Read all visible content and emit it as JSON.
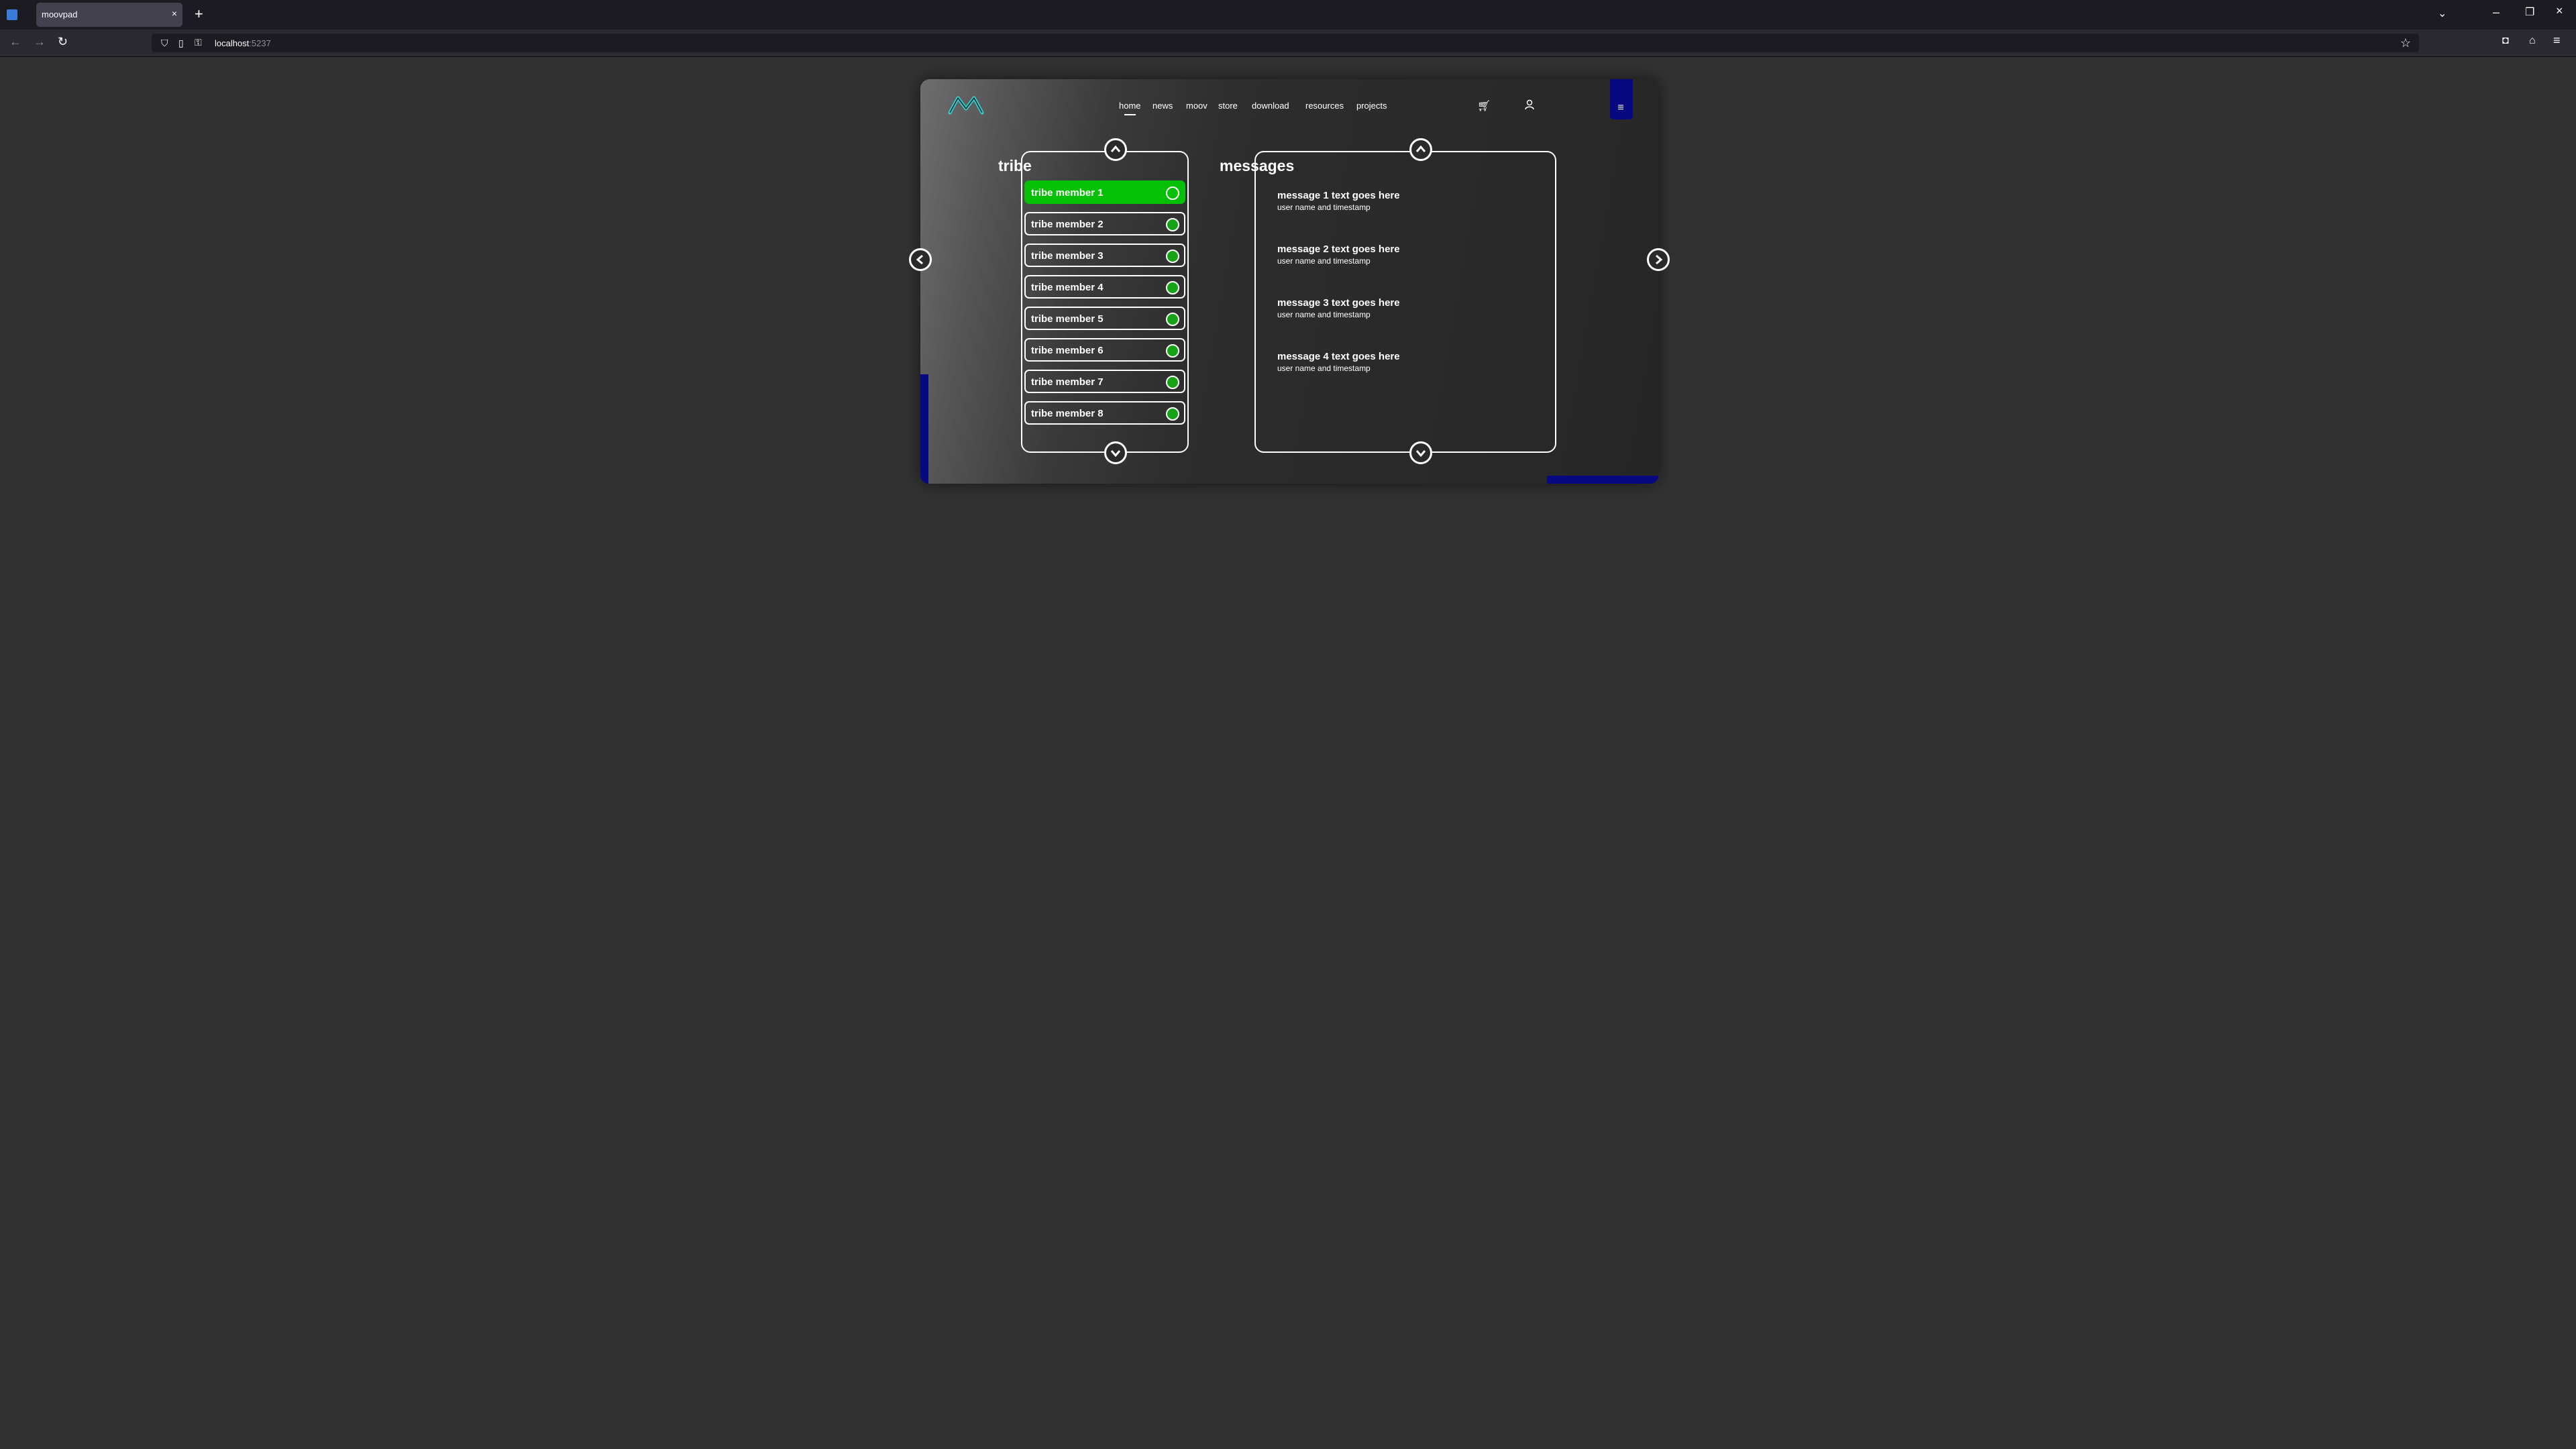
{
  "browser": {
    "tab_title": "moovpad",
    "tab_close": "×",
    "new_tab": "+",
    "url_host": "localhost",
    "url_port": ":5237"
  },
  "app": {
    "nav": [
      {
        "label": "home",
        "active": true
      },
      {
        "label": "news"
      },
      {
        "label": "moov"
      },
      {
        "label": "store"
      },
      {
        "label": "download"
      },
      {
        "label": "resources"
      },
      {
        "label": "projects"
      }
    ],
    "colors": {
      "accent_blue": "#060980",
      "online_green": "#06c006",
      "logo_teal": "#2fd3d6"
    },
    "icons": {
      "cart": "cart-icon",
      "user": "user-icon",
      "menu": "menu-icon"
    },
    "tribe": {
      "title": "tribe",
      "members": [
        {
          "name": "tribe member 1",
          "selected": true
        },
        {
          "name": "tribe member 2"
        },
        {
          "name": "tribe member 3"
        },
        {
          "name": "tribe member 4"
        },
        {
          "name": "tribe member 5"
        },
        {
          "name": "tribe member 6"
        },
        {
          "name": "tribe member 7"
        },
        {
          "name": "tribe member 8"
        }
      ]
    },
    "messages": {
      "title": "messages",
      "items": [
        {
          "text": "message 1 text goes here",
          "meta": "user name and timestamp"
        },
        {
          "text": "message 2 text goes here",
          "meta": "user name and timestamp"
        },
        {
          "text": "message 3 text goes here",
          "meta": "user name and timestamp"
        },
        {
          "text": "message 4 text goes here",
          "meta": "user name and timestamp"
        }
      ]
    }
  }
}
